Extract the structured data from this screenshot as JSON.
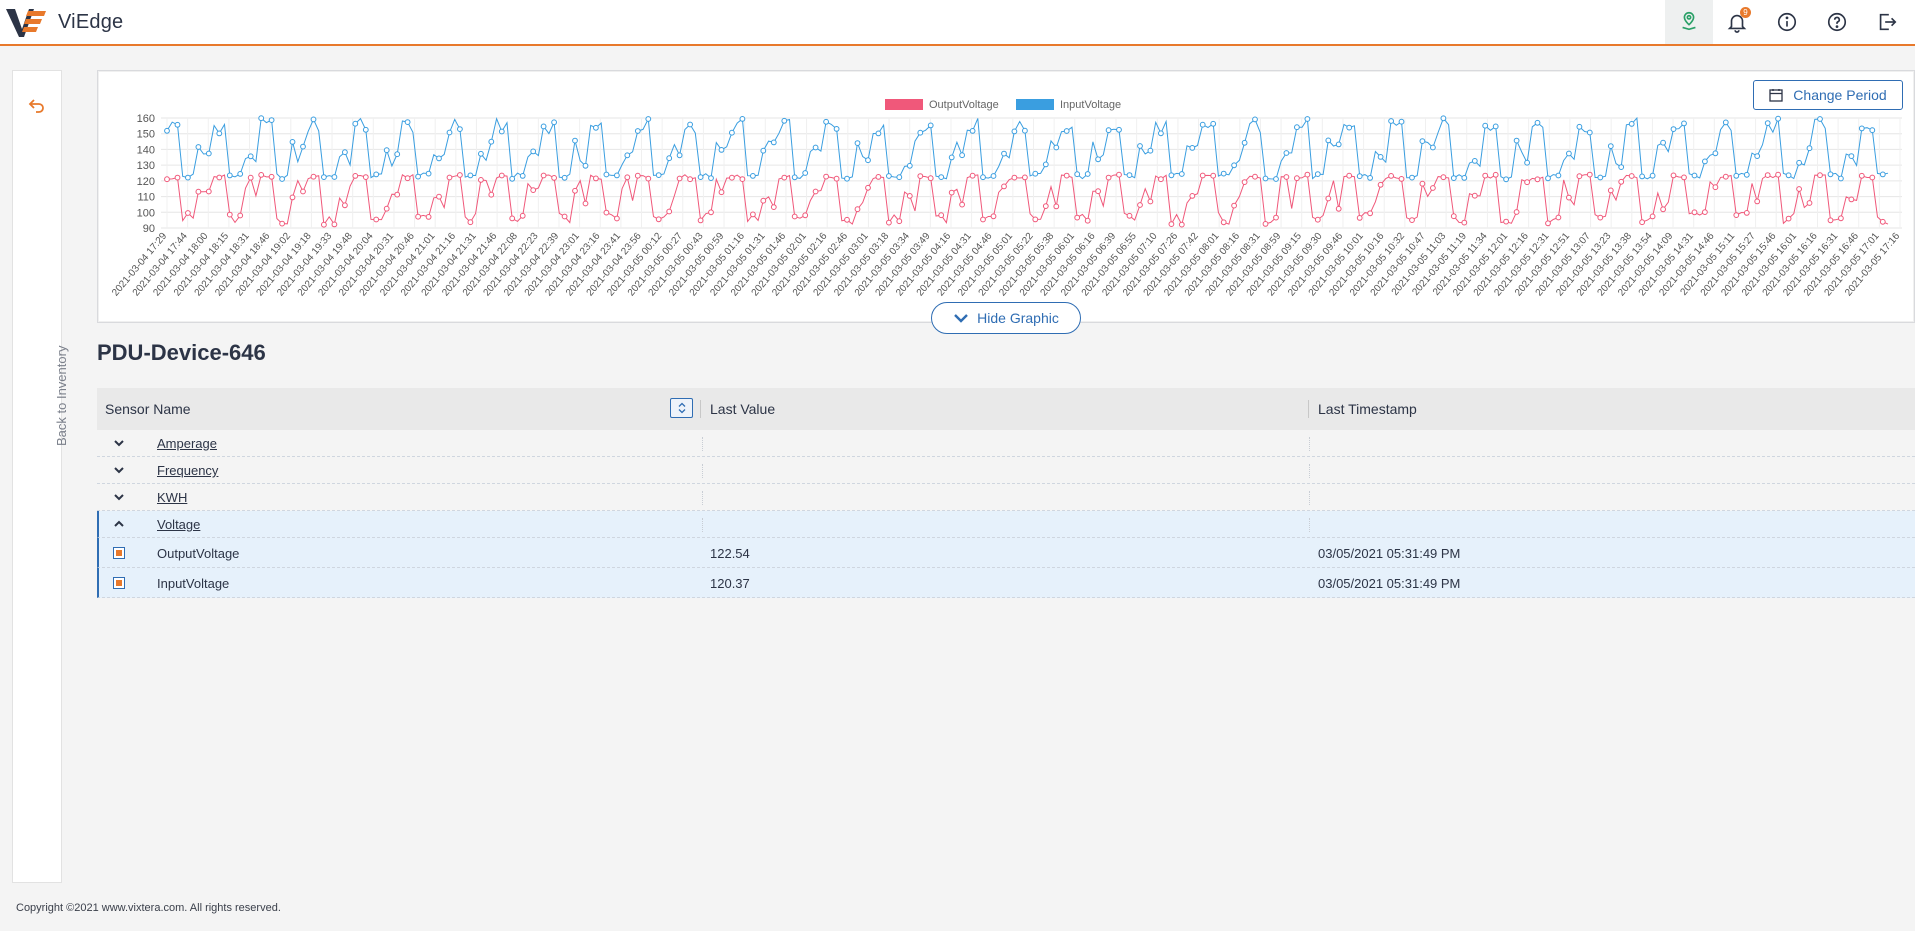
{
  "app": {
    "brand_prefix": "Vi",
    "brand_suffix": "Edge"
  },
  "topbar": {
    "icons": [
      "map-pin-icon",
      "bell-icon",
      "info-icon",
      "help-icon",
      "logout-icon"
    ],
    "notification_count": "9"
  },
  "sidebar": {
    "back_label": "Back to Inventory"
  },
  "chart": {
    "change_period_label": "Change Period",
    "hide_graphic_label": "Hide Graphic"
  },
  "device": {
    "title": "PDU-Device-646"
  },
  "table": {
    "headers": [
      "Sensor Name",
      "Last Value",
      "Last Timestamp"
    ],
    "groups": [
      {
        "name": "Amperage",
        "expanded": false
      },
      {
        "name": "Frequency",
        "expanded": false
      },
      {
        "name": "KWH",
        "expanded": false
      },
      {
        "name": "Voltage",
        "expanded": true
      }
    ],
    "children": [
      {
        "name": "OutputVoltage",
        "value": "122.54",
        "timestamp": "03/05/2021 05:31:49 PM"
      },
      {
        "name": "InputVoltage",
        "value": "120.37",
        "timestamp": "03/05/2021 05:31:49 PM"
      }
    ]
  },
  "footer": {
    "copyright": "Copyright ©2021 www.vixtera.com. All rights reserved."
  },
  "colors": {
    "accent": "#e8792b",
    "primary": "#2f6db3",
    "output": "#f0587a",
    "input": "#3a9ee0"
  },
  "chart_data": {
    "type": "line",
    "series": [
      {
        "name": "OutputVoltage",
        "values": []
      },
      {
        "name": "InputVoltage",
        "values": []
      }
    ],
    "y_ticks": [
      90,
      100,
      110,
      120,
      130,
      140,
      150,
      160
    ],
    "ylim": [
      90,
      160
    ],
    "x_tick_labels": [
      "2021-03-04 17:29",
      "2021-03-04 17:44",
      "2021-03-04 18:00",
      "2021-03-04 18:15",
      "2021-03-04 18:31",
      "2021-03-04 18:46",
      "2021-03-04 19:02",
      "2021-03-04 19:18",
      "2021-03-04 19:33",
      "2021-03-04 19:48",
      "2021-03-04 20:04",
      "2021-03-04 20:31",
      "2021-03-04 20:46",
      "2021-03-04 21:01",
      "2021-03-04 21:16",
      "2021-03-04 21:31",
      "2021-03-04 21:46",
      "2021-03-04 22:08",
      "2021-03-04 22:23",
      "2021-03-04 22:39",
      "2021-03-04 23:01",
      "2021-03-04 23:16",
      "2021-03-04 23:41",
      "2021-03-04 23:56",
      "2021-03-05 00:12",
      "2021-03-05 00:27",
      "2021-03-05 00:43",
      "2021-03-05 00:59",
      "2021-03-05 01:16",
      "2021-03-05 01:31",
      "2021-03-05 01:46",
      "2021-03-05 02:01",
      "2021-03-05 02:16",
      "2021-03-05 02:46",
      "2021-03-05 03:01",
      "2021-03-05 03:18",
      "2021-03-05 03:34",
      "2021-03-05 03:49",
      "2021-03-05 04:16",
      "2021-03-05 04:31",
      "2021-03-05 04:46",
      "2021-03-05 05:01",
      "2021-03-05 05:22",
      "2021-03-05 05:38",
      "2021-03-05 06:01",
      "2021-03-05 06:16",
      "2021-03-05 06:39",
      "2021-03-05 06:55",
      "2021-03-05 07:10",
      "2021-03-05 07:26",
      "2021-03-05 07:42",
      "2021-03-05 08:01",
      "2021-03-05 08:16",
      "2021-03-05 08:31",
      "2021-03-05 08:59",
      "2021-03-05 09:15",
      "2021-03-05 09:30",
      "2021-03-05 09:46",
      "2021-03-05 10:01",
      "2021-03-05 10:16",
      "2021-03-05 10:32",
      "2021-03-05 10:47",
      "2021-03-05 11:03",
      "2021-03-05 11:19",
      "2021-03-05 11:34",
      "2021-03-05 12:01",
      "2021-03-05 12:16",
      "2021-03-05 12:31",
      "2021-03-05 12:51",
      "2021-03-05 13:07",
      "2021-03-05 13:23",
      "2021-03-05 13:38",
      "2021-03-05 13:54",
      "2021-03-05 14:09",
      "2021-03-05 14:31",
      "2021-03-05 14:46",
      "2021-03-05 15:11",
      "2021-03-05 15:27",
      "2021-03-05 15:46",
      "2021-03-05 16:01",
      "2021-03-05 16:16",
      "2021-03-05 16:31",
      "2021-03-05 16:46",
      "2021-03-05 17:01",
      "2021-03-05 17:16"
    ],
    "legend": "top-center",
    "grid": true
  }
}
